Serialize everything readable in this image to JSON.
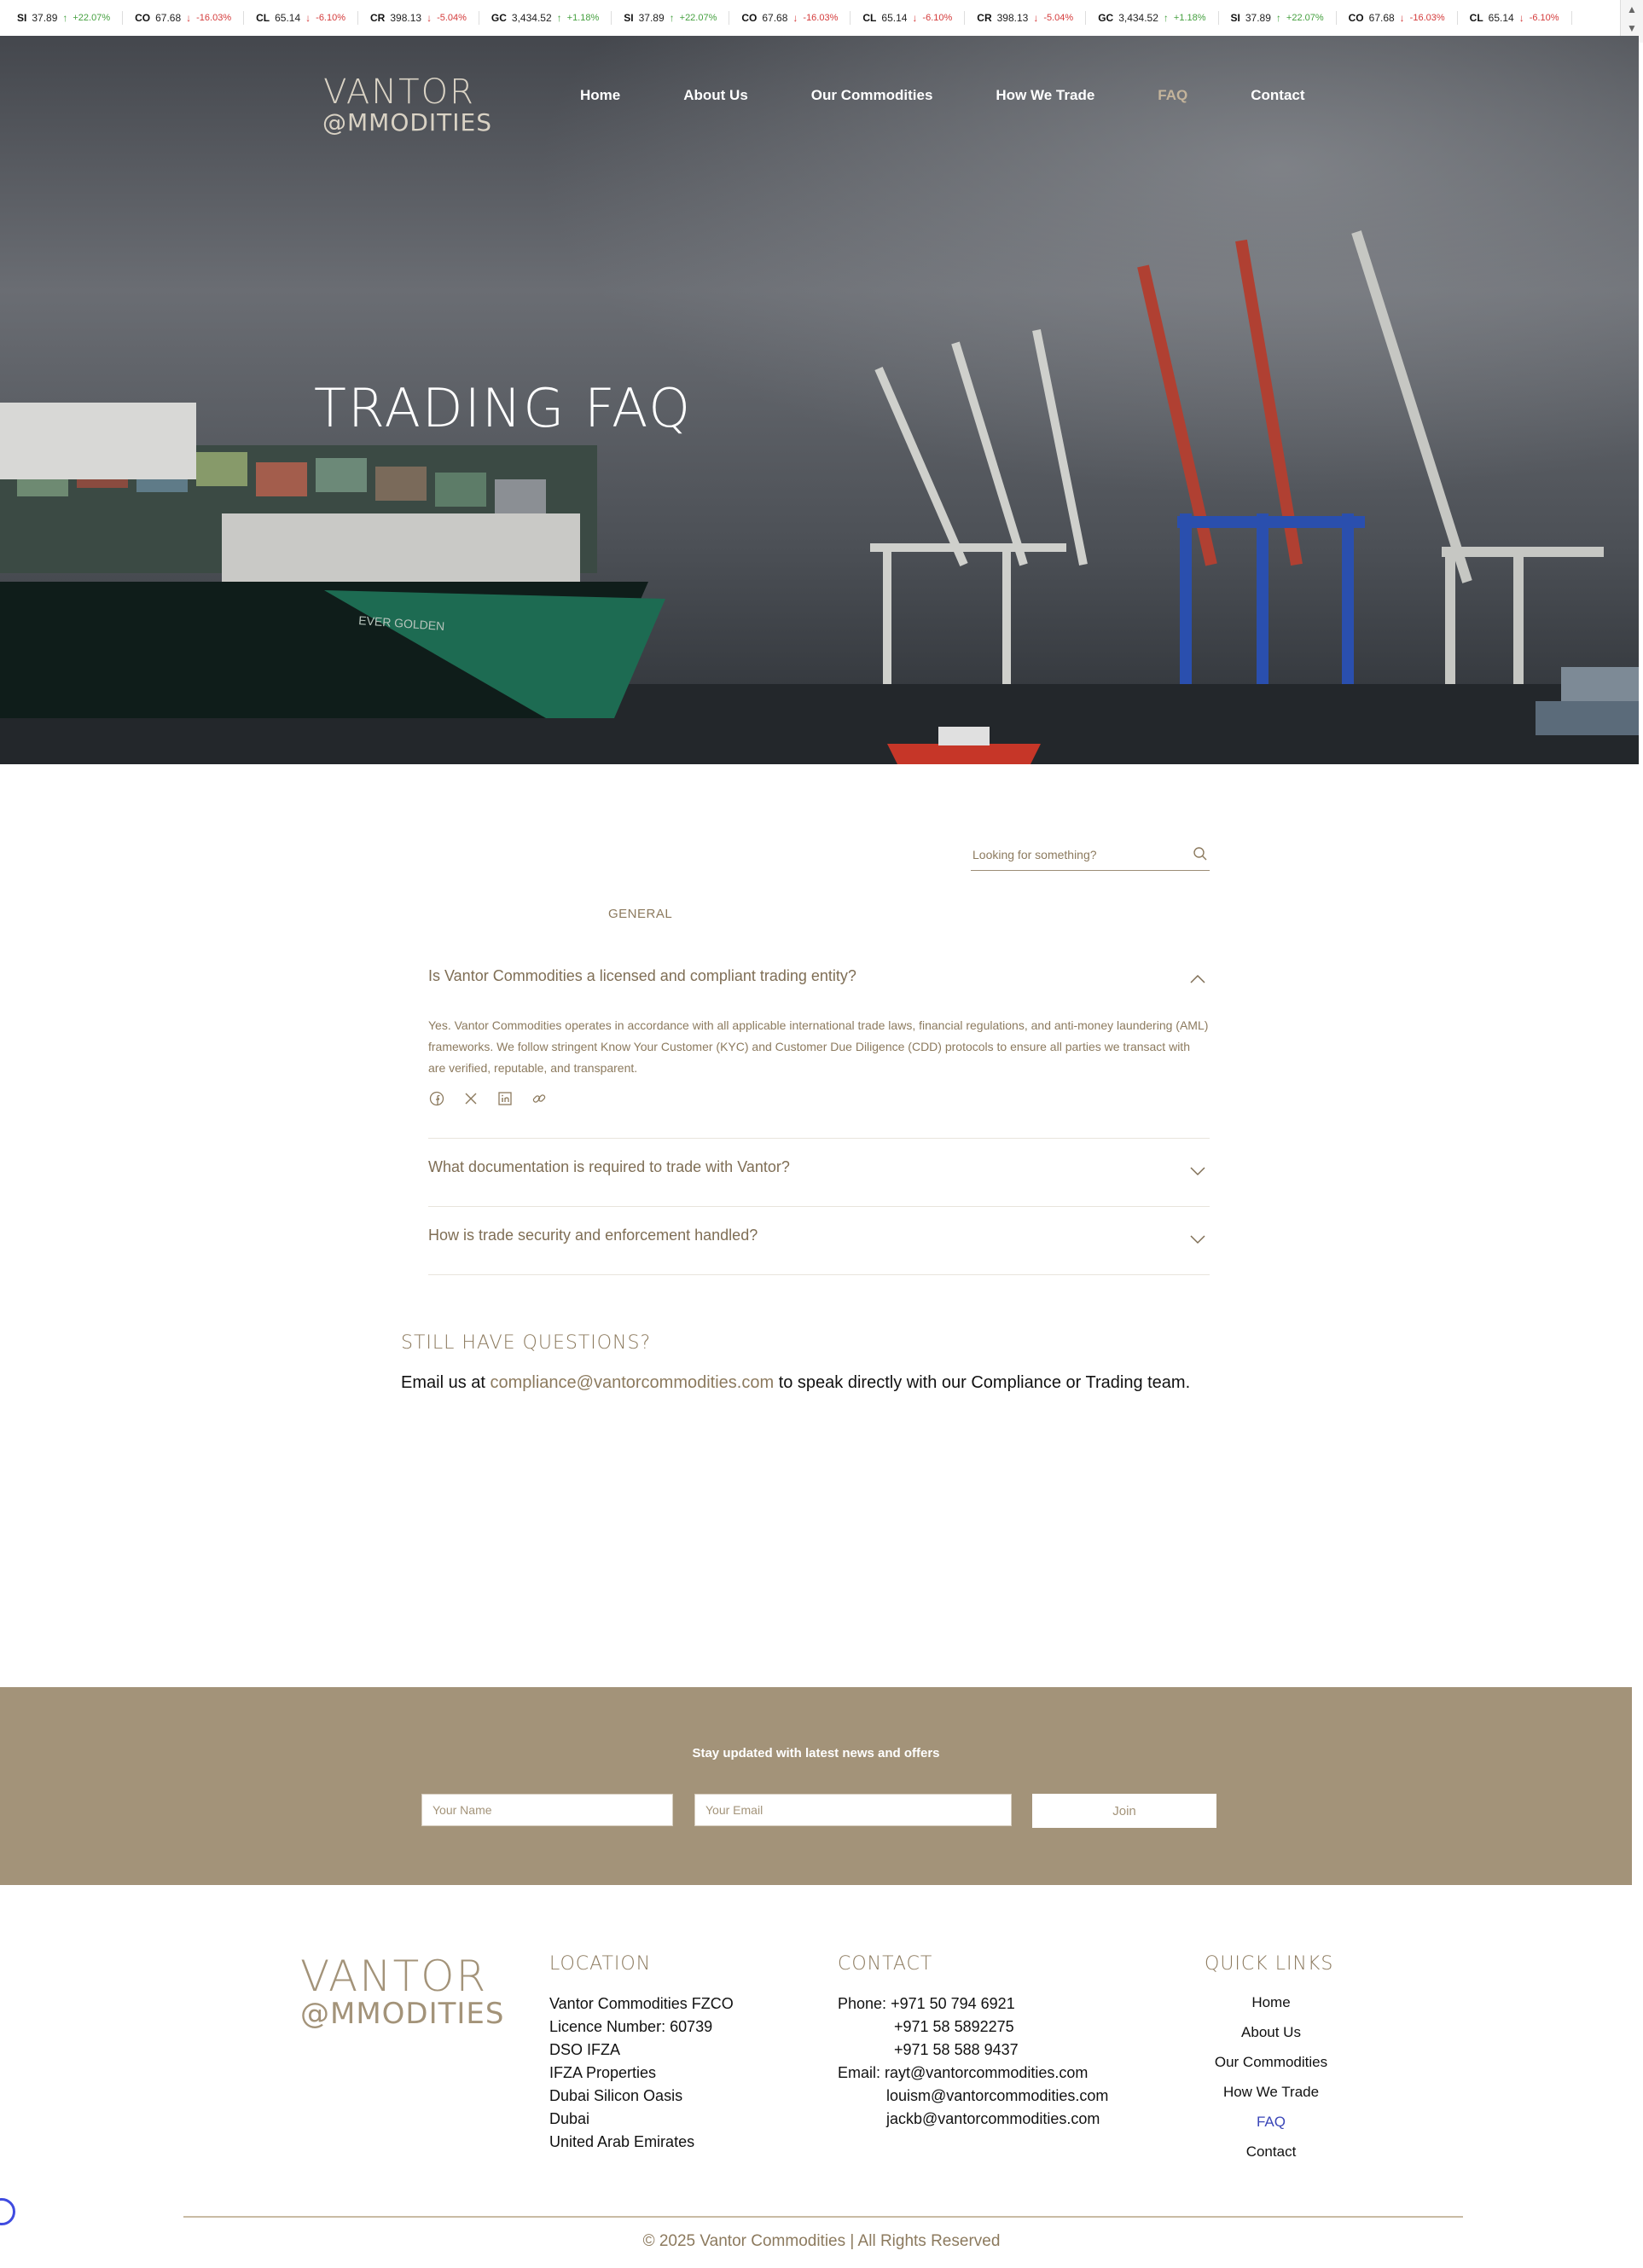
{
  "ticker": [
    {
      "sym": "SI",
      "price": "37.89",
      "change": "+22.07%",
      "dir": "up"
    },
    {
      "sym": "CO",
      "price": "67.68",
      "change": "-16.03%",
      "dir": "down"
    },
    {
      "sym": "CL",
      "price": "65.14",
      "change": "-6.10%",
      "dir": "down"
    },
    {
      "sym": "CR",
      "price": "398.13",
      "change": "-5.04%",
      "dir": "down"
    },
    {
      "sym": "GC",
      "price": "3,434.52",
      "change": "+1.18%",
      "dir": "up"
    },
    {
      "sym": "SI",
      "price": "37.89",
      "change": "+22.07%",
      "dir": "up"
    },
    {
      "sym": "CO",
      "price": "67.68",
      "change": "-16.03%",
      "dir": "down"
    },
    {
      "sym": "CL",
      "price": "65.14",
      "change": "-6.10%",
      "dir": "down"
    },
    {
      "sym": "CR",
      "price": "398.13",
      "change": "-5.04%",
      "dir": "down"
    },
    {
      "sym": "GC",
      "price": "3,434.52",
      "change": "+1.18%",
      "dir": "up"
    },
    {
      "sym": "SI",
      "price": "37.89",
      "change": "+22.07%",
      "dir": "up"
    },
    {
      "sym": "CO",
      "price": "67.68",
      "change": "-16.03%",
      "dir": "down"
    },
    {
      "sym": "CL",
      "price": "65.14",
      "change": "-6.10%",
      "dir": "down"
    }
  ],
  "brand": {
    "line1": "VANTOR",
    "line2": "@MMODITIES"
  },
  "nav": {
    "items": [
      "Home",
      "About Us",
      "Our Commodities",
      "How We Trade",
      "FAQ",
      "Contact"
    ],
    "active": "FAQ"
  },
  "hero": {
    "title": "TRADING FAQ"
  },
  "faq": {
    "search_placeholder": "Looking for something?",
    "category": "GENERAL",
    "items": [
      {
        "question": "Is Vantor Commodities a licensed and compliant trading entity?",
        "answer": "Yes. Vantor Commodities operates in accordance with all applicable international trade laws, financial regulations, and anti-money laundering (AML) frameworks. We follow stringent Know Your Customer (KYC) and Customer Due Diligence (CDD) protocols to ensure all parties we transact with are verified, reputable, and transparent.",
        "expanded": true
      },
      {
        "question": "What documentation is required to trade with Vantor?",
        "expanded": false
      },
      {
        "question": "How is trade security and enforcement handled?",
        "expanded": false
      }
    ]
  },
  "still": {
    "heading": "STILL HAVE QUESTIONS?",
    "prefix": "Email us at ",
    "email": "compliance@vantorcommodities.com",
    "suffix": " to speak directly with our Compliance or Trading team."
  },
  "newsletter": {
    "heading": "Stay updated with latest news and offers",
    "name_placeholder": "Your Name",
    "email_placeholder": "Your Email",
    "join_label": "Join"
  },
  "footer": {
    "location_heading": "LOCATION",
    "location_lines": [
      "Vantor Commodities FZCO",
      "Licence Number: 60739",
      "DSO IFZA",
      "IFZA Properties",
      "Dubai Silicon Oasis",
      "Dubai",
      "United Arab Emirates"
    ],
    "contact_heading": "CONTACT",
    "phone_label": "Phone: ",
    "phones": [
      "+971 50 794 6921",
      "+971 58 5892275",
      "+971 58 588 9437"
    ],
    "email_label": "Email: ",
    "emails": [
      "rayt@vantorcommodities.com",
      "louism@vantorcommodities.com",
      "jackb@vantorcommodities.com"
    ],
    "quicklinks_heading": "QUICK LINKS",
    "quicklinks": [
      "Home",
      "About Us",
      "Our Commodities",
      "How We Trade",
      "FAQ",
      "Contact"
    ],
    "quicklinks_active": "FAQ",
    "copyright": "© 2025 Vantor Commodities | All Rights Reserved"
  },
  "colors": {
    "accent": "#a39379",
    "text_accent": "#8c7a5e",
    "link_active": "#3a46b8",
    "up": "#45a03f",
    "down": "#d43a3a"
  }
}
